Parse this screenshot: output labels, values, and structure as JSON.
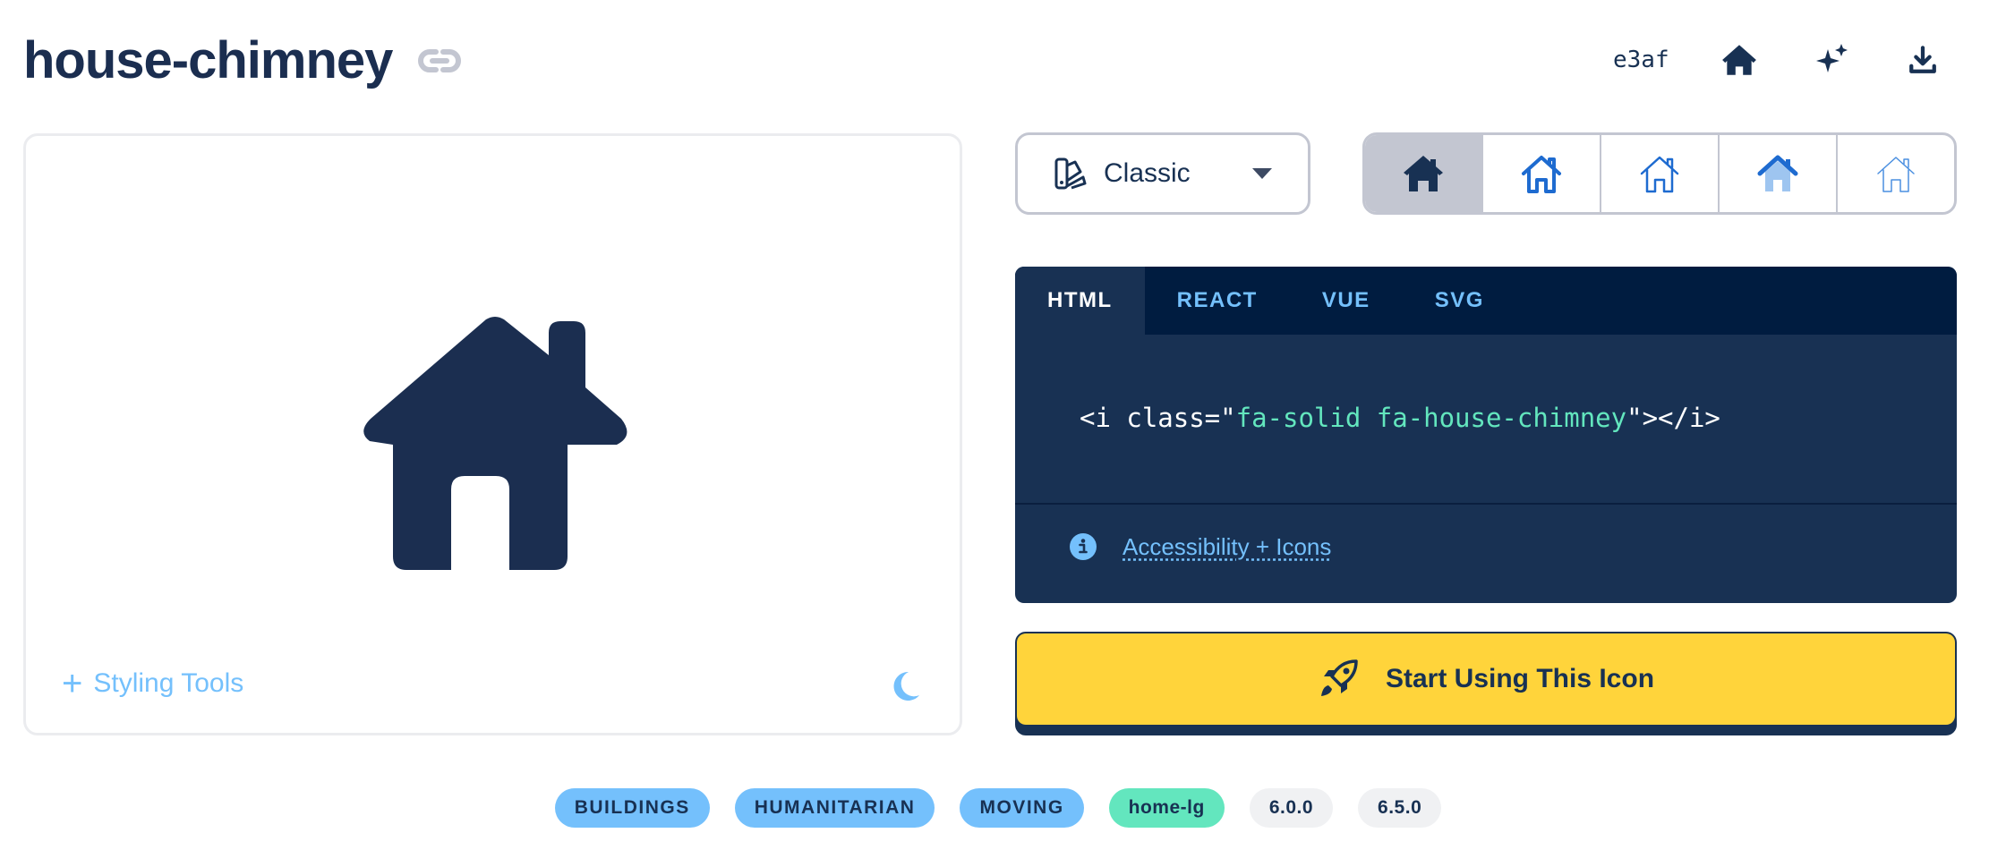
{
  "header": {
    "title": "house-chimney",
    "unicode": "e3af",
    "link_icon": "link-icon",
    "actions": [
      "house-icon",
      "sparkles-icon",
      "download-icon"
    ]
  },
  "preview": {
    "icon": "house-chimney-icon",
    "styling_tools_label": "Styling Tools",
    "theme_toggle_icon": "moon-icon"
  },
  "family_select": {
    "icon": "palette-icon",
    "value": "Classic"
  },
  "styles": [
    "solid",
    "regular",
    "light",
    "duotone",
    "thin"
  ],
  "code": {
    "tabs": [
      "HTML",
      "REACT",
      "VUE",
      "SVG"
    ],
    "active_tab": "HTML",
    "snippet_pre": "<i class=\"",
    "snippet_class": "fa-solid fa-house-chimney",
    "snippet_post": "\"></i>",
    "accessibility_link": "Accessibility + Icons"
  },
  "start_button": {
    "label": "Start Using This Icon",
    "icon": "rocket-icon"
  },
  "tags": {
    "categories": [
      "BUILDINGS",
      "HUMANITARIAN",
      "MOVING"
    ],
    "alias": "home-lg",
    "versions": [
      "6.0.0",
      "6.5.0"
    ]
  },
  "colors": {
    "navy": "#183153",
    "sky": "#74c0fc",
    "mint": "#63e6be",
    "yellow": "#ffd43b"
  }
}
